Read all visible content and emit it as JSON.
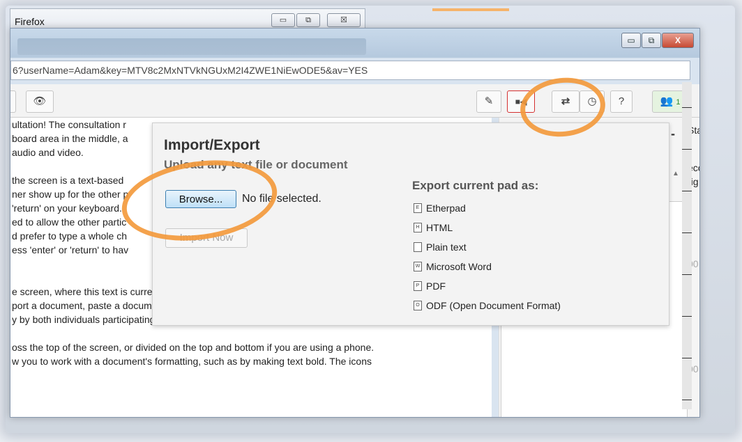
{
  "bg_window": {
    "title": "Firefox",
    "min_label": "▭",
    "max_label": "⧉",
    "close_label": "☒"
  },
  "main_window": {
    "min_label": "▭",
    "max_label": "⧉",
    "close_label": "X"
  },
  "url": "6?userName=Adam&key=MTV8c2MxNTVkNGUxM2I4ZWE1NiEwODE5&av=YES",
  "toolbar": {
    "eye_icon": "👁",
    "pencil_icon": "✎",
    "video_icon": "■◀",
    "swap_icon": "⇄",
    "clock_icon": "◷",
    "help_label": "?",
    "users_icon": "👥",
    "user_count": "1"
  },
  "doc_lines": [
    "ultation! The consultation r",
    "board area in the middle, a",
    "audio and video.",
    "",
    "the screen is a text-based",
    "ner show up for the other p",
    "'return' on your keyboard.",
    "ed to allow the other partic",
    "d prefer to type a whole ch",
    "ess 'enter' or 'return' to hav",
    "",
    "",
    "e screen, where this text is currently located, is the document collaboration",
    "port a document, paste a document, or type text. Changes made to text in this",
    "y by both individuals participating in the online consultation.",
    "",
    "oss the top of the screen, or divided on the top and bottom if you are using a phone.",
    "w you to work with a document's formatting, such as by making text bold. The icons"
  ],
  "sidebar": {
    "text_1": "Sta",
    "text_2": "eco",
    "text_3": "rig",
    "text_4": "00",
    "text_5": "00"
  },
  "popup": {
    "title": "Import/Export",
    "subtitle": "Upload any text file or document",
    "browse_label": "Browse...",
    "file_status": "No file selected.",
    "import_label": "Import Now",
    "export_heading": "Export current pad as:",
    "export_options": [
      {
        "icon": "E",
        "label": "Etherpad"
      },
      {
        "icon": "H",
        "label": "HTML"
      },
      {
        "icon": "",
        "label": "Plain text"
      },
      {
        "icon": "W",
        "label": "Microsoft Word"
      },
      {
        "icon": "P",
        "label": "PDF"
      },
      {
        "icon": "O",
        "label": "ODF (Open Document Format)"
      }
    ],
    "collapse_label": "-"
  },
  "colors": {
    "annotation": "#f39a3d",
    "video_border": "#d43030",
    "users_icon": "#2b8a2b"
  }
}
